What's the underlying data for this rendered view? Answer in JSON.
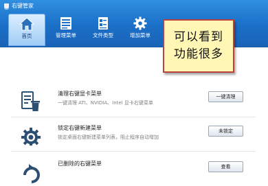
{
  "window": {
    "title": "右键管家"
  },
  "nav": {
    "items": [
      {
        "label": "首页",
        "icon": "home-icon",
        "active": true
      },
      {
        "label": "管理菜单",
        "icon": "list-icon",
        "active": false
      },
      {
        "label": "文件类型",
        "icon": "file-type-icon",
        "active": false
      },
      {
        "label": "增加菜单",
        "icon": "gear-icon",
        "active": false
      }
    ]
  },
  "callout": {
    "line1": "可以看到",
    "line2": "功能很多"
  },
  "rows": [
    {
      "icon": "trash-icon",
      "title": "清理右键显卡菜单",
      "desc": "一键清理 ATI、NVIDIA、Intel 显卡右键菜单",
      "button": "一键清理"
    },
    {
      "icon": "gear-icon",
      "title": "锁定右键新建菜单",
      "desc": "锁定桌面右键新建菜单列表，阻止程序自动增加",
      "button": "未锁定"
    },
    {
      "icon": "restore-icon",
      "title": "已删除的右键菜单",
      "desc": "",
      "button": "查看"
    }
  ],
  "colors": {
    "header": "#1b6fc7",
    "accent": "#0f3f78",
    "callout_bg": "#fff7b3",
    "callout_border": "#b8433d"
  }
}
